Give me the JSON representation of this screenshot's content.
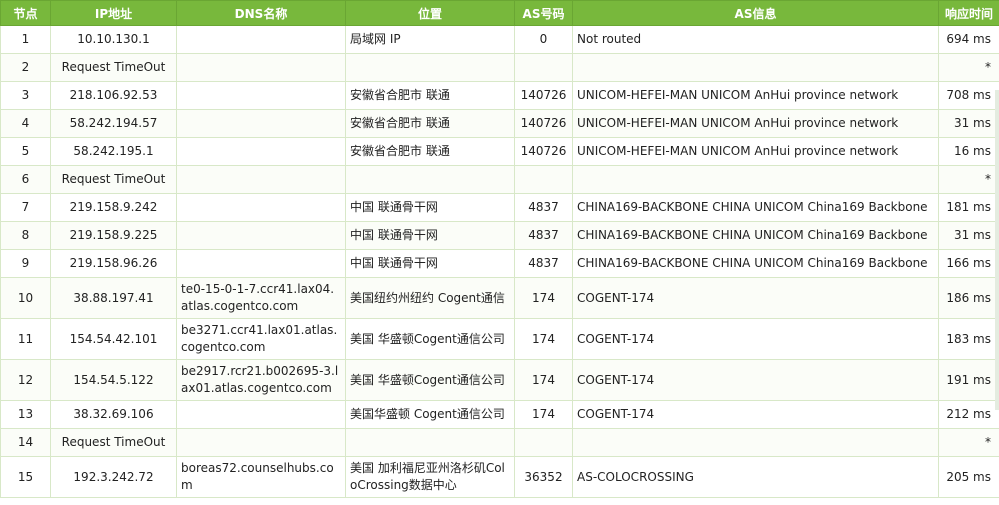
{
  "columns": [
    "节点",
    "IP地址",
    "DNS名称",
    "位置",
    "AS号码",
    "AS信息",
    "响应时间"
  ],
  "hops": [
    {
      "hop": "1",
      "ip": "10.10.130.1",
      "dns": "",
      "location": "局域网 IP",
      "asn": "0",
      "asinfo": "Not routed",
      "time": "694 ms"
    },
    {
      "hop": "2",
      "ip": "Request TimeOut",
      "dns": "",
      "location": "",
      "asn": "",
      "asinfo": "",
      "time": "*"
    },
    {
      "hop": "3",
      "ip": "218.106.92.53",
      "dns": "",
      "location": "安徽省合肥市 联通",
      "asn": "140726",
      "asinfo": "UNICOM-HEFEI-MAN UNICOM AnHui province network",
      "time": "708 ms"
    },
    {
      "hop": "4",
      "ip": "58.242.194.57",
      "dns": "",
      "location": "安徽省合肥市 联通",
      "asn": "140726",
      "asinfo": "UNICOM-HEFEI-MAN UNICOM AnHui province network",
      "time": "31 ms"
    },
    {
      "hop": "5",
      "ip": "58.242.195.1",
      "dns": "",
      "location": "安徽省合肥市 联通",
      "asn": "140726",
      "asinfo": "UNICOM-HEFEI-MAN UNICOM AnHui province network",
      "time": "16 ms"
    },
    {
      "hop": "6",
      "ip": "Request TimeOut",
      "dns": "",
      "location": "",
      "asn": "",
      "asinfo": "",
      "time": "*"
    },
    {
      "hop": "7",
      "ip": "219.158.9.242",
      "dns": "",
      "location": "中国 联通骨干网",
      "asn": "4837",
      "asinfo": "CHINA169-BACKBONE CHINA UNICOM China169 Backbone",
      "time": "181 ms"
    },
    {
      "hop": "8",
      "ip": "219.158.9.225",
      "dns": "",
      "location": "中国 联通骨干网",
      "asn": "4837",
      "asinfo": "CHINA169-BACKBONE CHINA UNICOM China169 Backbone",
      "time": "31 ms"
    },
    {
      "hop": "9",
      "ip": "219.158.96.26",
      "dns": "",
      "location": "中国 联通骨干网",
      "asn": "4837",
      "asinfo": "CHINA169-BACKBONE CHINA UNICOM China169 Backbone",
      "time": "166 ms"
    },
    {
      "hop": "10",
      "ip": "38.88.197.41",
      "dns": "te0-15-0-1-7.ccr41.lax04.atlas.cogentco.com",
      "location": "美国纽约州纽约 Cogent通信",
      "asn": "174",
      "asinfo": "COGENT-174",
      "time": "186 ms"
    },
    {
      "hop": "11",
      "ip": "154.54.42.101",
      "dns": "be3271.ccr41.lax01.atlas.cogentco.com",
      "location": "美国 华盛顿Cogent通信公司",
      "asn": "174",
      "asinfo": "COGENT-174",
      "time": "183 ms"
    },
    {
      "hop": "12",
      "ip": "154.54.5.122",
      "dns": "be2917.rcr21.b002695-3.lax01.atlas.cogentco.com",
      "location": "美国 华盛顿Cogent通信公司",
      "asn": "174",
      "asinfo": "COGENT-174",
      "time": "191 ms"
    },
    {
      "hop": "13",
      "ip": "38.32.69.106",
      "dns": "",
      "location": "美国华盛顿 Cogent通信公司",
      "asn": "174",
      "asinfo": "COGENT-174",
      "time": "212 ms"
    },
    {
      "hop": "14",
      "ip": "Request TimeOut",
      "dns": "",
      "location": "",
      "asn": "",
      "asinfo": "",
      "time": "*"
    },
    {
      "hop": "15",
      "ip": "192.3.242.72",
      "dns": "boreas72.counselhubs.com",
      "location": "美国 加利福尼亚州洛杉矶ColoCrossing数据中心",
      "asn": "36352",
      "asinfo": "AS-COLOCROSSING",
      "time": "205 ms"
    }
  ]
}
